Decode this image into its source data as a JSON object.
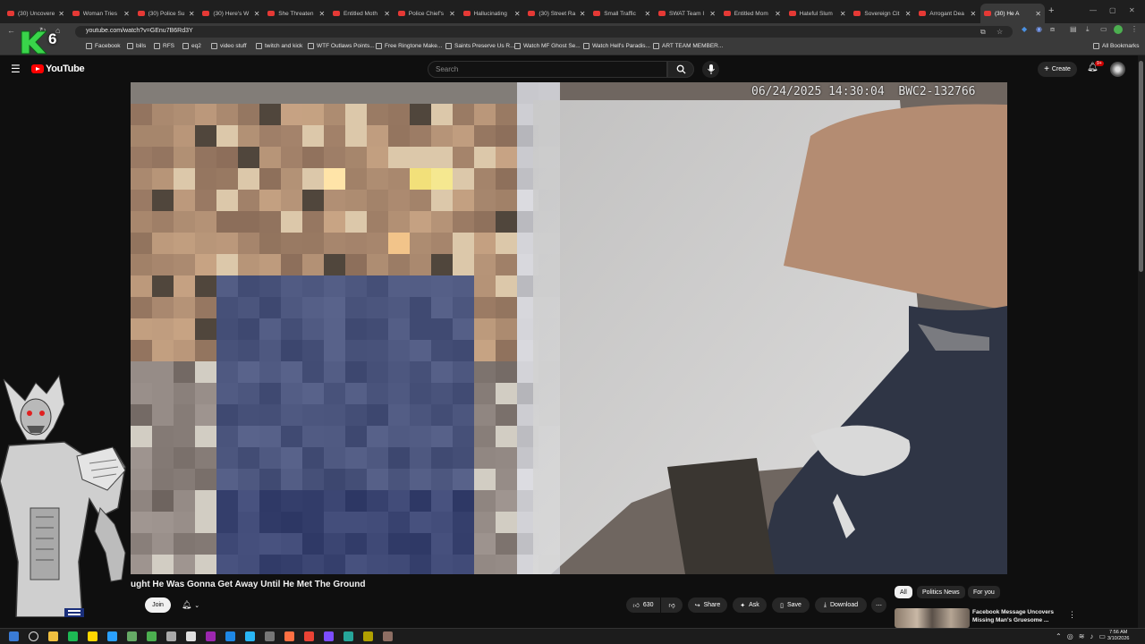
{
  "browser": {
    "tabs": [
      {
        "title": "(30) Uncovere"
      },
      {
        "title": "Woman Tries"
      },
      {
        "title": "(30) Police Su"
      },
      {
        "title": "(30) Here's W"
      },
      {
        "title": "She Threaten"
      },
      {
        "title": "Entitled Moth"
      },
      {
        "title": "Police Chief's"
      },
      {
        "title": "Hallucinating"
      },
      {
        "title": "(30) Street Ra"
      },
      {
        "title": "Small Traffic"
      },
      {
        "title": "SWAT Team I"
      },
      {
        "title": "Entitled Mom"
      },
      {
        "title": "Hateful Slum"
      },
      {
        "title": "Sovereign Cit"
      },
      {
        "title": "Arrogant Dea"
      },
      {
        "title": "(30) He A",
        "active": true
      }
    ],
    "url": "youtube.com/watch?v=GEnu7B6Rd3Y",
    "bookmarks": [
      {
        "label": "Facebook"
      },
      {
        "label": "bills"
      },
      {
        "label": "RFS"
      },
      {
        "label": "eq2"
      },
      {
        "label": "video stuff"
      },
      {
        "label": "twitch and kick"
      },
      {
        "label": "WTF Outlaws Points..."
      },
      {
        "label": "Free Ringtone Make..."
      },
      {
        "label": "Saints Preserve Us R..."
      },
      {
        "label": "Watch MF Ghost Se..."
      },
      {
        "label": "Watch Hell's Paradis..."
      },
      {
        "label": "ART TEAM MEMBER..."
      }
    ],
    "all_bookmarks": "All Bookmarks"
  },
  "youtube": {
    "logo_text": "YouTube",
    "search_placeholder": "Search",
    "create_label": "Create",
    "notification_badge": "9+",
    "video": {
      "overlay_timestamp": "06/24/2025 14:30:04",
      "overlay_camera_id": "BWC2-132766",
      "title": "ught He Was Gonna Get Away Until He Met The Ground",
      "join_label": "Join",
      "like_count": "630",
      "share_label": "Share",
      "ask_label": "Ask",
      "save_label": "Save",
      "download_label": "Download"
    },
    "chips": [
      "All",
      "Politics News",
      "For you"
    ],
    "recommendation": {
      "title": "Facebook Message Uncovers Missing Man's Gruesome ..."
    }
  },
  "streamer_badge": "6",
  "taskbar": {
    "time": "7:56 AM",
    "date": "3/10/2026"
  }
}
